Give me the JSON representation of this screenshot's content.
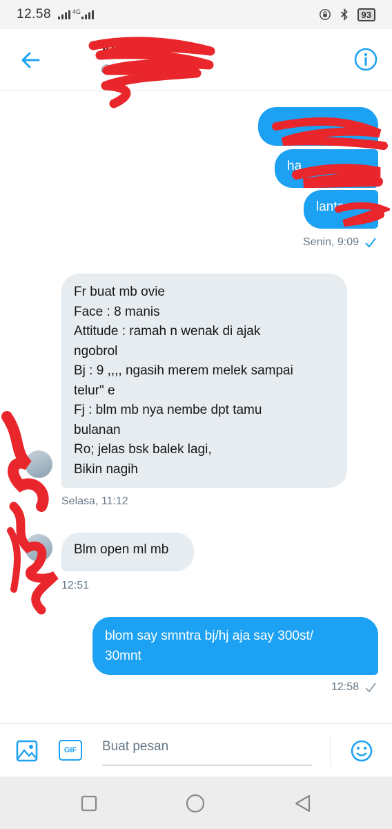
{
  "status_bar": {
    "time": "12.58",
    "network_type": "4G",
    "battery": "93"
  },
  "header": {
    "contact_name": "Ai",
    "contact_handle": "@"
  },
  "messages": [
    {
      "direction": "out",
      "text": "",
      "partial_visible": ""
    },
    {
      "direction": "out",
      "text": "",
      "partial_visible": "ha"
    },
    {
      "direction": "out",
      "text": "",
      "partial_visible": "lantar"
    },
    {
      "direction": "meta",
      "text": "Senin, 9:09"
    },
    {
      "direction": "in",
      "lines": [
        "Fr buat mb ovie",
        "Face : 8 manis",
        "Attitude : ramah n wenak di ajak",
        "ngobrol",
        "Bj : 9 ,,,, ngasih merem melek sampai",
        "telur\" e",
        "Fj : blm mb nya nembe dpt tamu",
        "bulanan",
        "Ro;  jelas bsk balek lagi,",
        "Bikin nagih"
      ]
    },
    {
      "direction": "meta",
      "text": "Selasa, 11:12"
    },
    {
      "direction": "in",
      "text": "Blm open ml mb"
    },
    {
      "direction": "meta",
      "text": "12:51"
    },
    {
      "direction": "out",
      "lines": [
        "blom say smntra bj/hj aja say 300st/",
        "30mnt"
      ]
    },
    {
      "direction": "meta",
      "text": "12:58"
    }
  ],
  "composer": {
    "placeholder": "Buat pesan",
    "gif_label": "GIF"
  },
  "colors": {
    "accent": "#1da1f2",
    "incoming_bubble": "#e6ecf0",
    "meta_text": "#657786",
    "redaction": "#e8262b"
  },
  "icons": [
    "back-arrow-icon",
    "info-icon",
    "image-icon",
    "gif-icon",
    "emoji-icon",
    "recents-icon",
    "home-icon",
    "back-triangle-icon",
    "read-check-icon",
    "sent-check-icon"
  ]
}
